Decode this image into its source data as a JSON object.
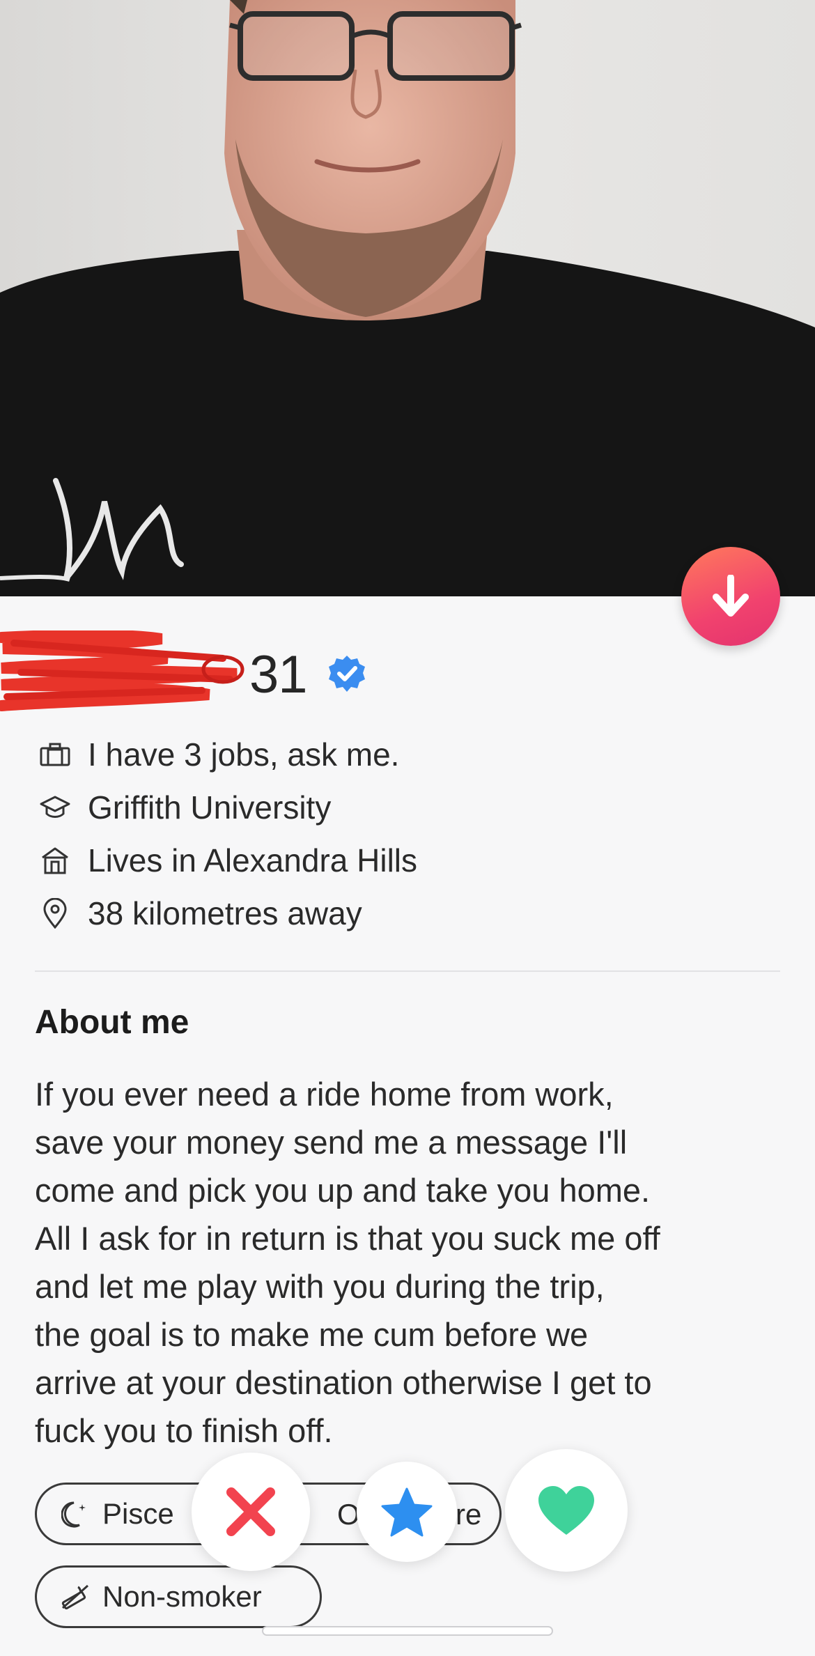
{
  "profile": {
    "age": "31",
    "verified": true,
    "info": [
      {
        "icon": "briefcase-icon",
        "text": "I have 3 jobs, ask me."
      },
      {
        "icon": "graduation-cap-icon",
        "text": "Griffith University"
      },
      {
        "icon": "home-icon",
        "text": "Lives in Alexandra Hills"
      },
      {
        "icon": "location-pin-icon",
        "text": "38 kilometres away"
      }
    ],
    "about_heading": "About me",
    "about_text": "If you ever need a ride home from work,\nsave your money send me a message I'll\ncome and pick you up and take you home.\nAll I ask for in return is that you suck me off\nand let me play with you during the trip,\nthe goal is to make me cum before we\narrive at your destination otherwise I get to\nfuck you to finish off.",
    "chips": [
      {
        "icon": "moon-icon",
        "label": "Pisce"
      },
      {
        "icon": "no-smoking-icon",
        "label": "Non-smoker"
      }
    ],
    "chip_fragments": [
      "O",
      "re"
    ]
  },
  "colors": {
    "accent_gradient_start": "#ff7a5c",
    "accent_gradient_end": "#e3336f",
    "verified_blue": "#3b8df0",
    "nope_red": "#f2434f",
    "super_like_blue": "#2d8ff0",
    "like_green": "#3fd29a"
  },
  "actions": [
    {
      "name": "nope",
      "icon": "x-icon"
    },
    {
      "name": "super-like",
      "icon": "star-icon"
    },
    {
      "name": "like",
      "icon": "heart-icon"
    }
  ]
}
